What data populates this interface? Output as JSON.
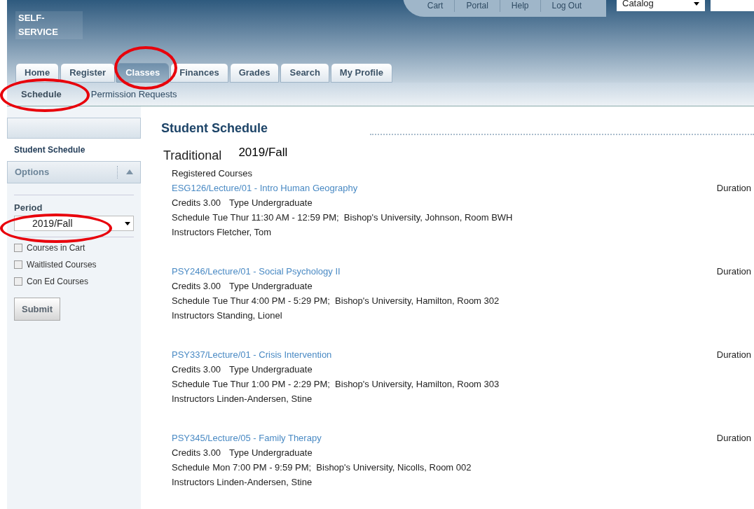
{
  "header": {
    "logo": "SELF-SERVICE",
    "top_links": [
      "Cart",
      "Portal",
      "Help",
      "Log Out"
    ],
    "search_scope": "Catalog"
  },
  "tabs": [
    {
      "label": "Home",
      "selected": false
    },
    {
      "label": "Register",
      "selected": false
    },
    {
      "label": "Classes",
      "selected": true
    },
    {
      "label": "Finances",
      "selected": false
    },
    {
      "label": "Grades",
      "selected": false
    },
    {
      "label": "Search",
      "selected": false
    },
    {
      "label": "My Profile",
      "selected": false
    }
  ],
  "subtabs": [
    {
      "label": "Schedule",
      "selected": true
    },
    {
      "label": "Permission Requests",
      "selected": false
    }
  ],
  "sidebar": {
    "title": "Student Schedule",
    "options_label": "Options",
    "period_label": "Period",
    "period_value": "2019/Fall",
    "checkboxes": [
      {
        "label": "Courses in Cart",
        "checked": false
      },
      {
        "label": "Waitlisted Courses",
        "checked": false
      },
      {
        "label": "Con Ed Courses",
        "checked": false
      }
    ],
    "submit": "Submit"
  },
  "main": {
    "title": "Student Schedule",
    "career": "Traditional",
    "term": "2019/Fall",
    "section": "Registered Courses",
    "courses": [
      {
        "name": "ESG126/Lecture/01 - Intro Human Geography",
        "duration": "Duration",
        "credits": "Credits 3.00",
        "type": "Type Undergraduate",
        "schedule_label": "Schedule",
        "schedule": "Tue Thur 11:30 AM - 12:59 PM;  Bishop's University, Johnson, Room BWH",
        "instructors": "Instructors Fletcher, Tom"
      },
      {
        "name": "PSY246/Lecture/01 - Social Psychology II",
        "duration": "Duration",
        "credits": "Credits 3.00",
        "type": "Type Undergraduate",
        "schedule_label": "Schedule",
        "schedule": "Tue Thur 4:00 PM - 5:29 PM;  Bishop's University, Hamilton, Room 302",
        "instructors": "Instructors Standing, Lionel"
      },
      {
        "name": "PSY337/Lecture/01 - Crisis Intervention",
        "duration": "Duration",
        "credits": "Credits 3.00",
        "type": "Type Undergraduate",
        "schedule_label": "Schedule",
        "schedule": "Tue Thur 1:00 PM - 2:29 PM;  Bishop's University, Hamilton, Room 303",
        "instructors": "Instructors Linden-Andersen, Stine"
      },
      {
        "name": "PSY345/Lecture/05 - Family Therapy",
        "duration": "Duration",
        "credits": "Credits 3.00",
        "type": "Type Undergraduate",
        "schedule_label": "Schedule",
        "schedule": "Mon 7:00 PM - 9:59 PM;  Bishop's University, Nicolls, Room 002",
        "instructors": "Instructors Linden-Andersen, Stine"
      }
    ]
  }
}
